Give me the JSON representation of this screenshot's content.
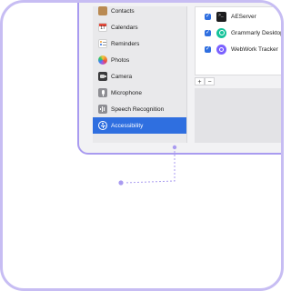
{
  "sidebar": {
    "items": [
      {
        "label": "Contacts",
        "icon": "contacts-icon",
        "selected": false
      },
      {
        "label": "Calendars",
        "icon": "calendar-icon",
        "selected": false
      },
      {
        "label": "Reminders",
        "icon": "reminders-icon",
        "selected": false
      },
      {
        "label": "Photos",
        "icon": "photos-icon",
        "selected": false
      },
      {
        "label": "Camera",
        "icon": "camera-icon",
        "selected": false
      },
      {
        "label": "Microphone",
        "icon": "microphone-icon",
        "selected": false
      },
      {
        "label": "Speech Recognition",
        "icon": "speech-recognition-icon",
        "selected": false
      },
      {
        "label": "Accessibility",
        "icon": "accessibility-icon",
        "selected": true
      }
    ]
  },
  "calendar_icon_day": "17",
  "apps": [
    {
      "name": "AEServer",
      "icon": "terminal-icon",
      "checked": true
    },
    {
      "name": "Grammarly Desktop",
      "icon": "grammarly-icon",
      "checked": true
    },
    {
      "name": "WebWork Tracker",
      "icon": "webwork-icon",
      "checked": true
    }
  ],
  "controls": {
    "add_label": "+",
    "remove_label": "−"
  },
  "colors": {
    "selection": "#2f6fe0",
    "accent_border": "#a99bf0",
    "frame_border": "#c7bdf3",
    "grammarly": "#15c39a",
    "webwork": "#7b61ff"
  }
}
